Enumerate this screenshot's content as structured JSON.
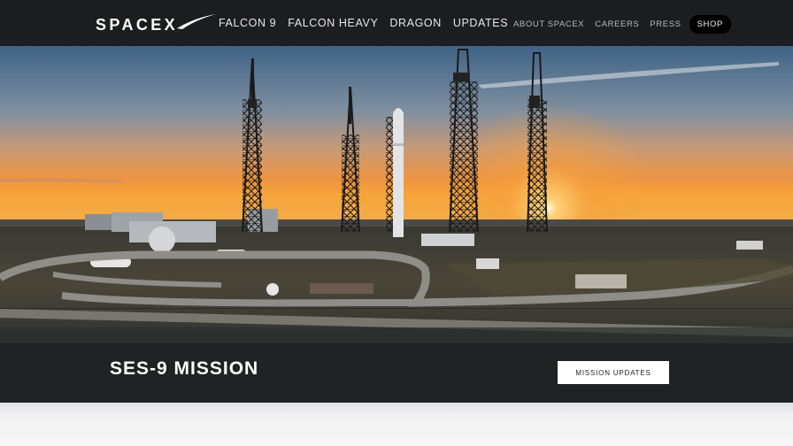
{
  "header": {
    "logo_text": "SPACEX",
    "nav_primary": [
      "FALCON 9",
      "FALCON HEAVY",
      "DRAGON",
      "UPDATES"
    ],
    "nav_secondary": [
      "ABOUT SPACEX",
      "CAREERS",
      "PRESS"
    ],
    "shop_label": "SHOP"
  },
  "hero": {
    "mission_title": "SES-9 MISSION",
    "button_label": "MISSION UPDATES"
  },
  "colors": {
    "header_bg": "#1b1d1f",
    "mission_bar_bg": "#202224",
    "sky_top": "#4a6b8c",
    "sunset": "#f29a3a"
  }
}
